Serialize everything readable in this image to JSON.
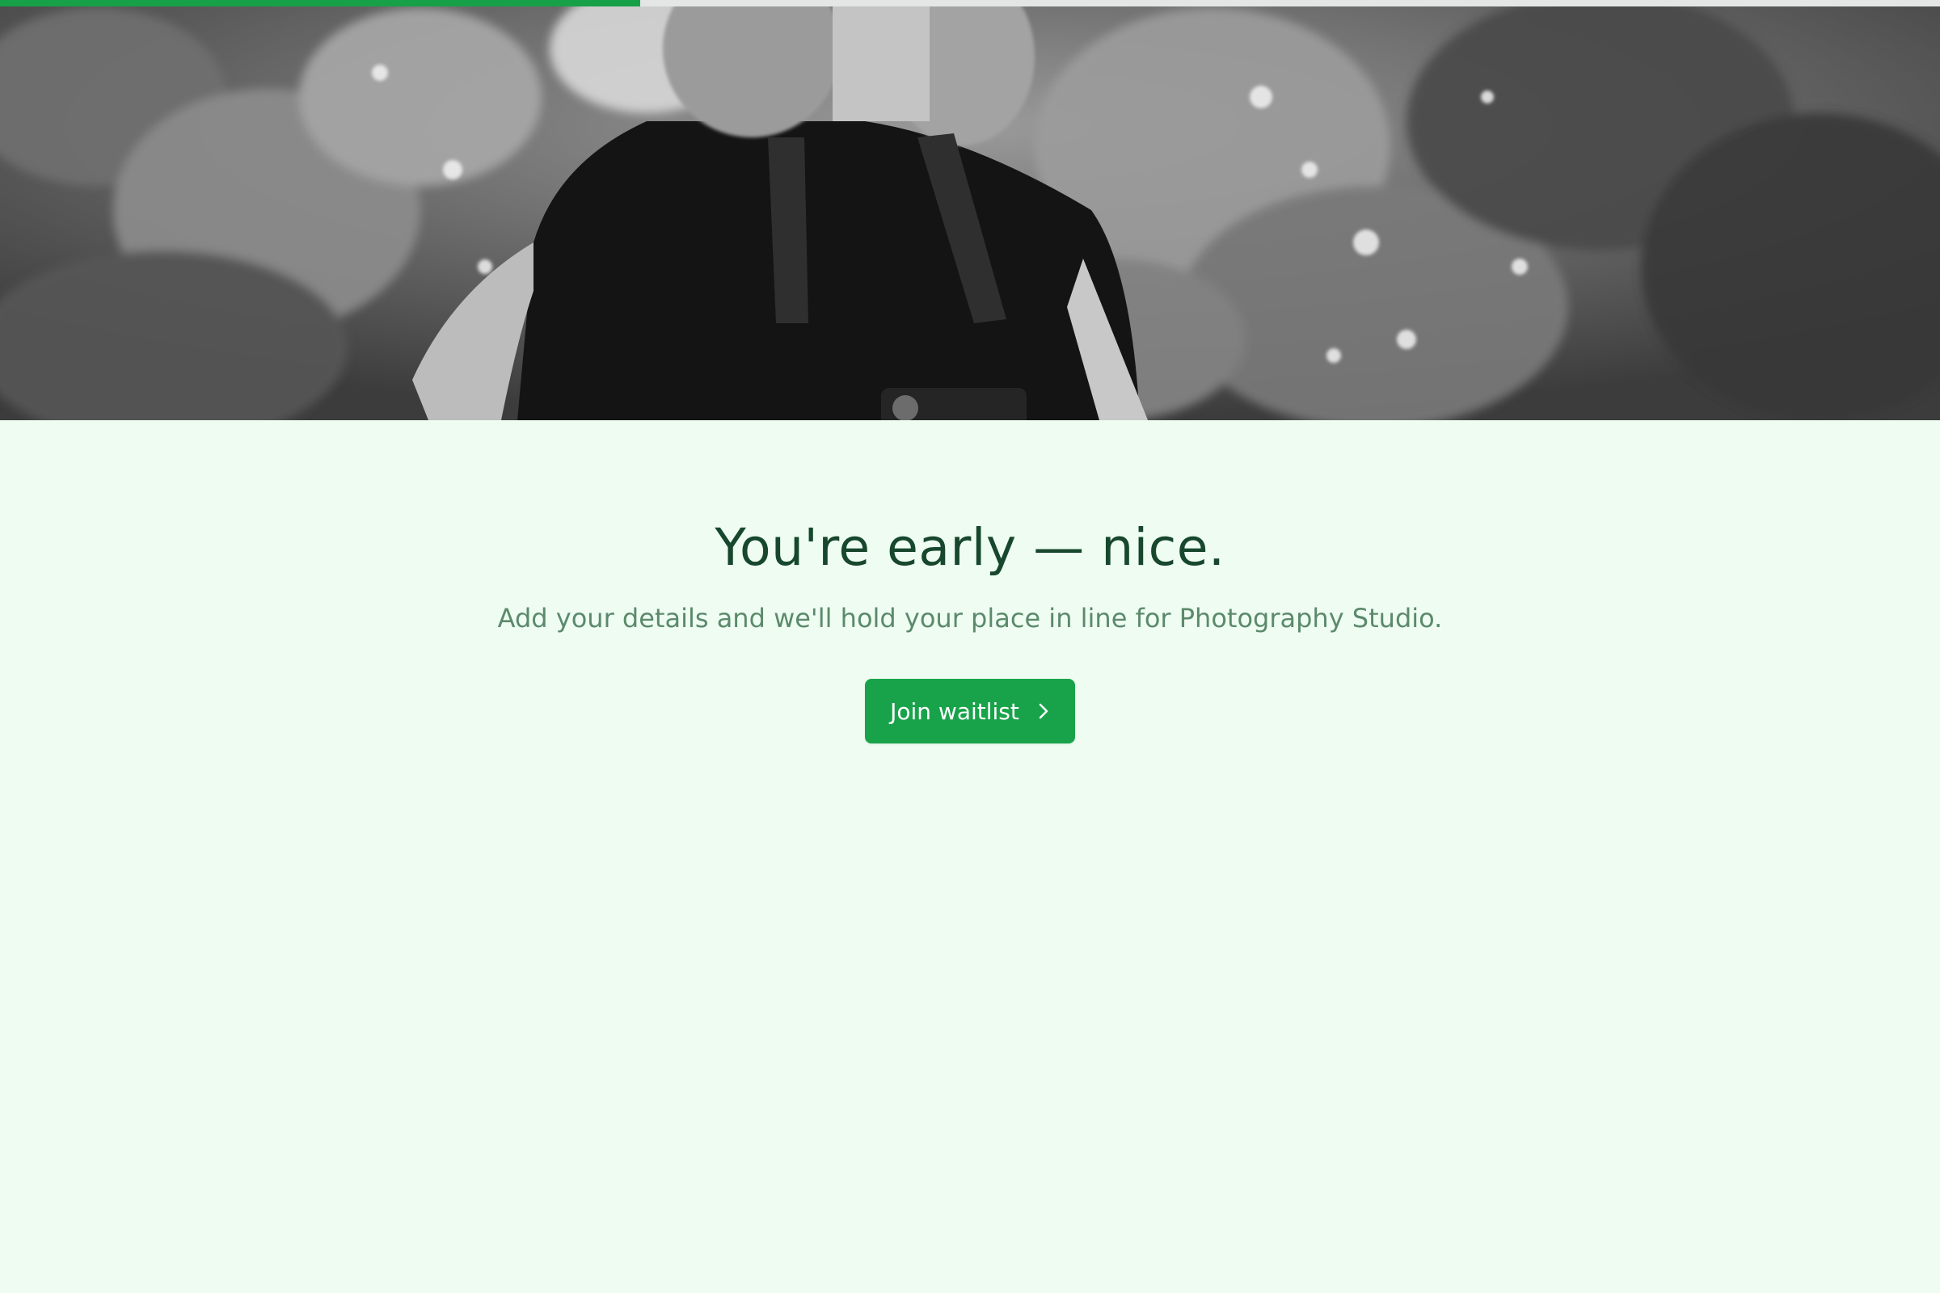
{
  "progress": {
    "value_percent": 33,
    "track_color": "#e4e6e6",
    "fill_color": "#18a049"
  },
  "hero": {
    "image": "photographer-with-camera-strap-grayscale"
  },
  "main": {
    "headline": "You're early — nice.",
    "subtitle": "Add your details and we'll hold your place in line for Photography Studio.",
    "cta_label": "Join waitlist",
    "cta_icon": "chevron-right-icon"
  },
  "colors": {
    "background": "#eefcf2",
    "headline": "#17472d",
    "subtitle": "#5b8a6b",
    "button": "#18a34a"
  }
}
